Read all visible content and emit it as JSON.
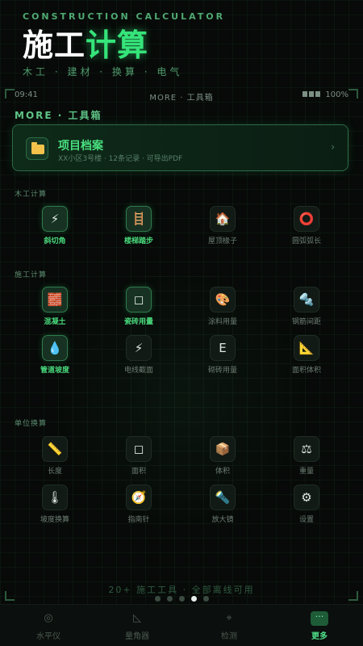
{
  "header": {
    "top_label": "CONSTRUCTION CALCULATOR",
    "title_white": "施工",
    "title_green": "计算",
    "subtitle": "木工 · 建材 · 换算 · 电气"
  },
  "status": {
    "time": "09:41",
    "center": "MORE · 工具箱",
    "battery": "100%"
  },
  "section": {
    "title": "MORE · 工具箱"
  },
  "project": {
    "title": "项目档案",
    "subtitle": "XX小区3号楼 · 12条记录 · 可导出PDF",
    "icon": "folder-icon"
  },
  "groups": {
    "woodwork": {
      "label": "木工计算",
      "items": [
        {
          "label": "斜切角",
          "icon": "lightning-icon",
          "glyph": "⚡"
        },
        {
          "label": "楼梯踏步",
          "icon": "ladder-icon",
          "glyph": "🪜"
        },
        {
          "label": "屋顶椽子",
          "icon": "house-icon",
          "glyph": "🏠"
        },
        {
          "label": "圆弧弧长",
          "icon": "ring-icon",
          "glyph": "⭕"
        }
      ]
    },
    "construction": {
      "label": "施工计算",
      "items": [
        {
          "label": "混凝土",
          "icon": "brick-icon",
          "glyph": "🧱"
        },
        {
          "label": "瓷砖用量",
          "icon": "tile-icon",
          "glyph": "◻"
        },
        {
          "label": "涂料用量",
          "icon": "palette-icon",
          "glyph": "🎨"
        },
        {
          "label": "钢筋间距",
          "icon": "bolt-icon",
          "glyph": "🔩"
        },
        {
          "label": "管道坡度",
          "icon": "droplet-icon",
          "glyph": "💧"
        },
        {
          "label": "电线截面",
          "icon": "lightning-icon",
          "glyph": "⚡"
        },
        {
          "label": "砌砖用量",
          "icon": "brick-wall-icon",
          "glyph": "Ε"
        },
        {
          "label": "面积体积",
          "icon": "triangle-ruler-icon",
          "glyph": "📐"
        }
      ]
    },
    "units": {
      "label": "单位换算",
      "items": [
        {
          "label": "长度",
          "icon": "ruler-icon",
          "glyph": "📏"
        },
        {
          "label": "面积",
          "icon": "square-icon",
          "glyph": "◻"
        },
        {
          "label": "体积",
          "icon": "box-icon",
          "glyph": "📦"
        },
        {
          "label": "重量",
          "icon": "scale-icon",
          "glyph": "⚖"
        },
        {
          "label": "坡度换算",
          "icon": "thermometer-icon",
          "glyph": "🌡"
        },
        {
          "label": "指南针",
          "icon": "compass-icon",
          "glyph": "🧭"
        },
        {
          "label": "放大镜",
          "icon": "flashlight-icon",
          "glyph": "🔦"
        },
        {
          "label": "设置",
          "icon": "gear-icon",
          "glyph": "⚙"
        }
      ]
    }
  },
  "footer_note": "20+ 施工工具 · 全部离线可用",
  "pager": {
    "count": 5,
    "active": 3
  },
  "tabs": [
    {
      "label": "水平仪",
      "icon": "level-icon",
      "glyph": "◎"
    },
    {
      "label": "量角器",
      "icon": "protractor-icon",
      "glyph": "◺"
    },
    {
      "label": "检测",
      "icon": "probe-icon",
      "glyph": "⌖"
    },
    {
      "label": "更多",
      "icon": "more-icon",
      "glyph": "···"
    }
  ],
  "colors": {
    "accent": "#35e47a",
    "background": "#070a08",
    "card_border": "#2c6a45"
  }
}
